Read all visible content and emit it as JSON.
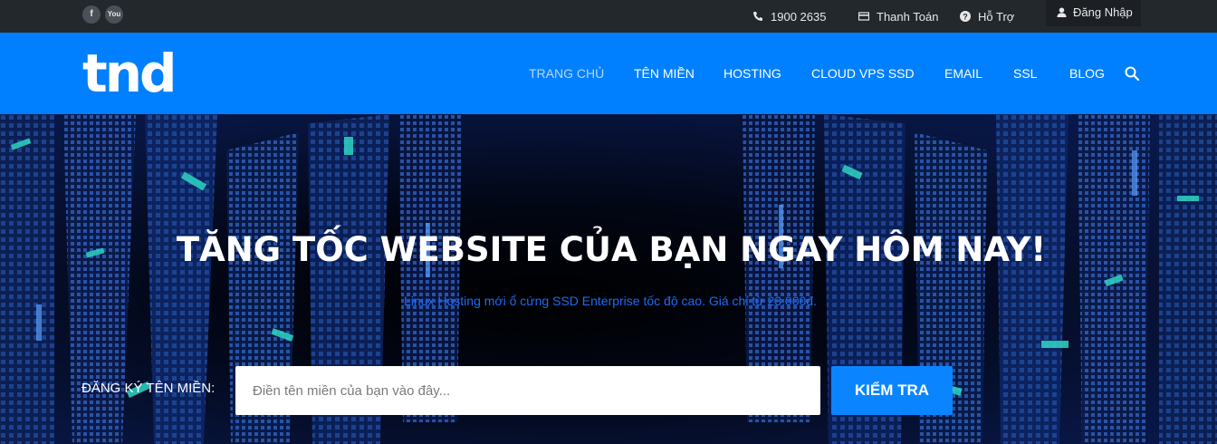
{
  "topbar": {
    "social": [
      {
        "icon": "facebook-icon",
        "glyph": "f"
      },
      {
        "icon": "youtube-icon",
        "glyph": "You"
      }
    ],
    "phone": "1900 2635",
    "payment": "Thanh Toán",
    "support": "Hỗ Trợ",
    "login": "Đăng Nhập"
  },
  "navbar": {
    "logo": "tnd",
    "items": [
      {
        "label": "TRANG CHỦ",
        "active": true
      },
      {
        "label": "TÊN MIỀN"
      },
      {
        "label": "HOSTING"
      },
      {
        "label": "CLOUD VPS SSD"
      },
      {
        "label": "EMAIL"
      },
      {
        "label": "SSL"
      },
      {
        "label": "BLOG"
      }
    ],
    "search_icon": "search-icon"
  },
  "hero": {
    "title": "TĂNG TỐC WEBSITE CỦA BẠN NGAY HÔM NAY!",
    "subtitle": "Linux Hosting mới ổ cứng SSD Enterprise tốc độ cao. Giá chỉ từ 23.000đ.",
    "domain_label": "ĐĂNG KÝ TÊN MIỀN:",
    "input_placeholder": "Điền tên miền của bạn vào đây...",
    "input_value": "",
    "button_label": "KIỂM TRA"
  },
  "colors": {
    "topbar": "#23282d",
    "navbar": "#0080fe",
    "accent_button": "#0a85ff",
    "subtitle": "#1f6bf2"
  }
}
